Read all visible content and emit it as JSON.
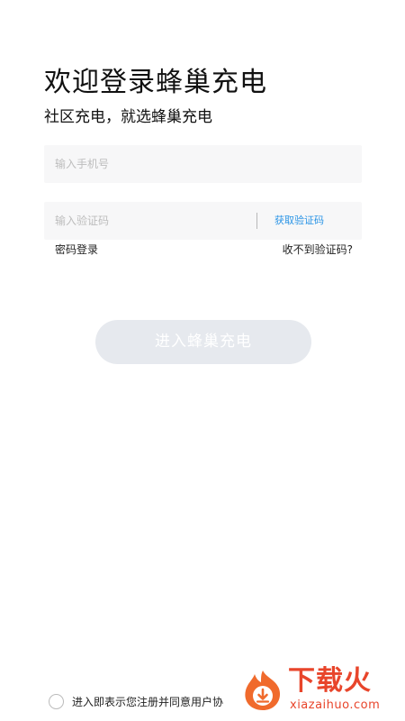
{
  "header": {
    "title": "欢迎登录蜂巢充电",
    "subtitle": "社区充电，就选蜂巢充电"
  },
  "form": {
    "phone_placeholder": "输入手机号",
    "phone_value": "",
    "code_placeholder": "输入验证码",
    "code_value": "",
    "get_code_label": "获取验证码",
    "accent_color": "#2a94e6"
  },
  "links": {
    "password_login": "密码登录",
    "no_code": "收不到验证码?"
  },
  "submit": {
    "label": "进入蜂巢充电",
    "bg_color": "#e6e9ee"
  },
  "agreement": {
    "text": "进入即表示您注册并同意用户协",
    "checked": false
  },
  "watermark": {
    "brand": "下载火",
    "url": "xiazaihuo.com",
    "color": "#e8452b"
  }
}
